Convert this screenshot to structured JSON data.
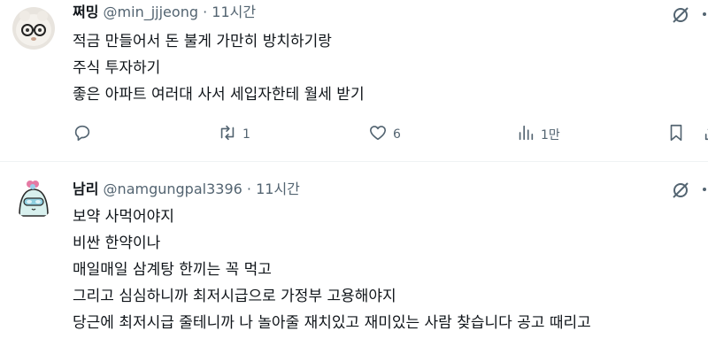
{
  "tweets": [
    {
      "name": "쩌밍",
      "handle": "@min_jjjeong",
      "dot": "·",
      "time": "11시간",
      "lines": [
        "적금 만들어서 돈 불게 가만히 방치하기랑",
        "주식 투자하기",
        "좋은 아파트 여러대 사서 세입자한테 월세 받기"
      ],
      "actions": {
        "replies": "",
        "reposts": "1",
        "likes": "6",
        "views": "1만"
      }
    },
    {
      "name": "남리",
      "handle": "@namgungpal3396",
      "dot": "·",
      "time": "11시간",
      "lines": [
        "보약 사먹어야지",
        "비싼 한약이나",
        "매일매일 삼계탕 한끼는 꼭 먹고",
        "그리고 심심하니까 최저시급으로 가정부 고용해야지",
        "당근에 최저시급 줄테니까 나 놀아줄 재치있고 재미있는 사람 찾습니다 공고 때리고"
      ]
    }
  ],
  "icons": {
    "grok": "grok-slash-icon",
    "more": "more-icon",
    "reply": "reply-icon",
    "repost": "repost-icon",
    "like": "heart-icon",
    "views": "views-icon",
    "bookmark": "bookmark-icon",
    "share": "share-icon"
  },
  "colors": {
    "text": "#0f1419",
    "secondary": "#536471",
    "divider": "#eff3f4"
  }
}
